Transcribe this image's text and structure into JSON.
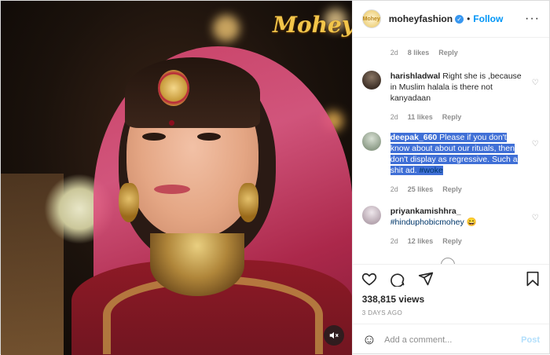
{
  "media": {
    "brand_logo": "Mohey",
    "mute_icon": "speaker-muted-icon"
  },
  "header": {
    "avatar_text": "Mohey",
    "username": "moheyfashion",
    "verified_icon": "verified-badge-icon",
    "separator": "•",
    "follow_label": "Follow",
    "more_icon": "more-options-icon"
  },
  "top_meta": {
    "time": "2d",
    "likes": "8 likes",
    "reply": "Reply"
  },
  "comments": [
    {
      "username": "harishladwal",
      "text": " Right she is ,because in Muslim halala is there not kanyadaan",
      "time": "2d",
      "likes": "11 likes",
      "reply": "Reply",
      "avatar_color": "#5c4a3d"
    },
    {
      "username": "deepak_660",
      "text": " Please if you don't know about about our rituals, then don't display as regressive. Such a shit ad. ",
      "hashtag": "#woke",
      "time": "2d",
      "likes": "25 likes",
      "reply": "Reply",
      "avatar_color": "#a9b8a6",
      "highlighted": true
    },
    {
      "username": "priyankamishhra_",
      "text": "",
      "hashtag": "#hinduphobicmohey",
      "emoji": "😄",
      "time": "2d",
      "likes": "12 likes",
      "reply": "Reply",
      "avatar_color": "#c9c2c8"
    }
  ],
  "actions": {
    "like_icon": "heart-icon",
    "comment_icon": "comment-icon",
    "share_icon": "share-icon",
    "save_icon": "bookmark-icon"
  },
  "views": "338,815 views",
  "posted": "3 DAYS AGO",
  "add_comment": {
    "placeholder": "Add a comment...",
    "post_label": "Post",
    "emoji_icon": "smiley-icon"
  },
  "colors": {
    "link_blue": "#0095f6",
    "hashtag_blue": "#00376b",
    "selection": "#3f6fd6",
    "muted_text": "#8e8e8e"
  }
}
